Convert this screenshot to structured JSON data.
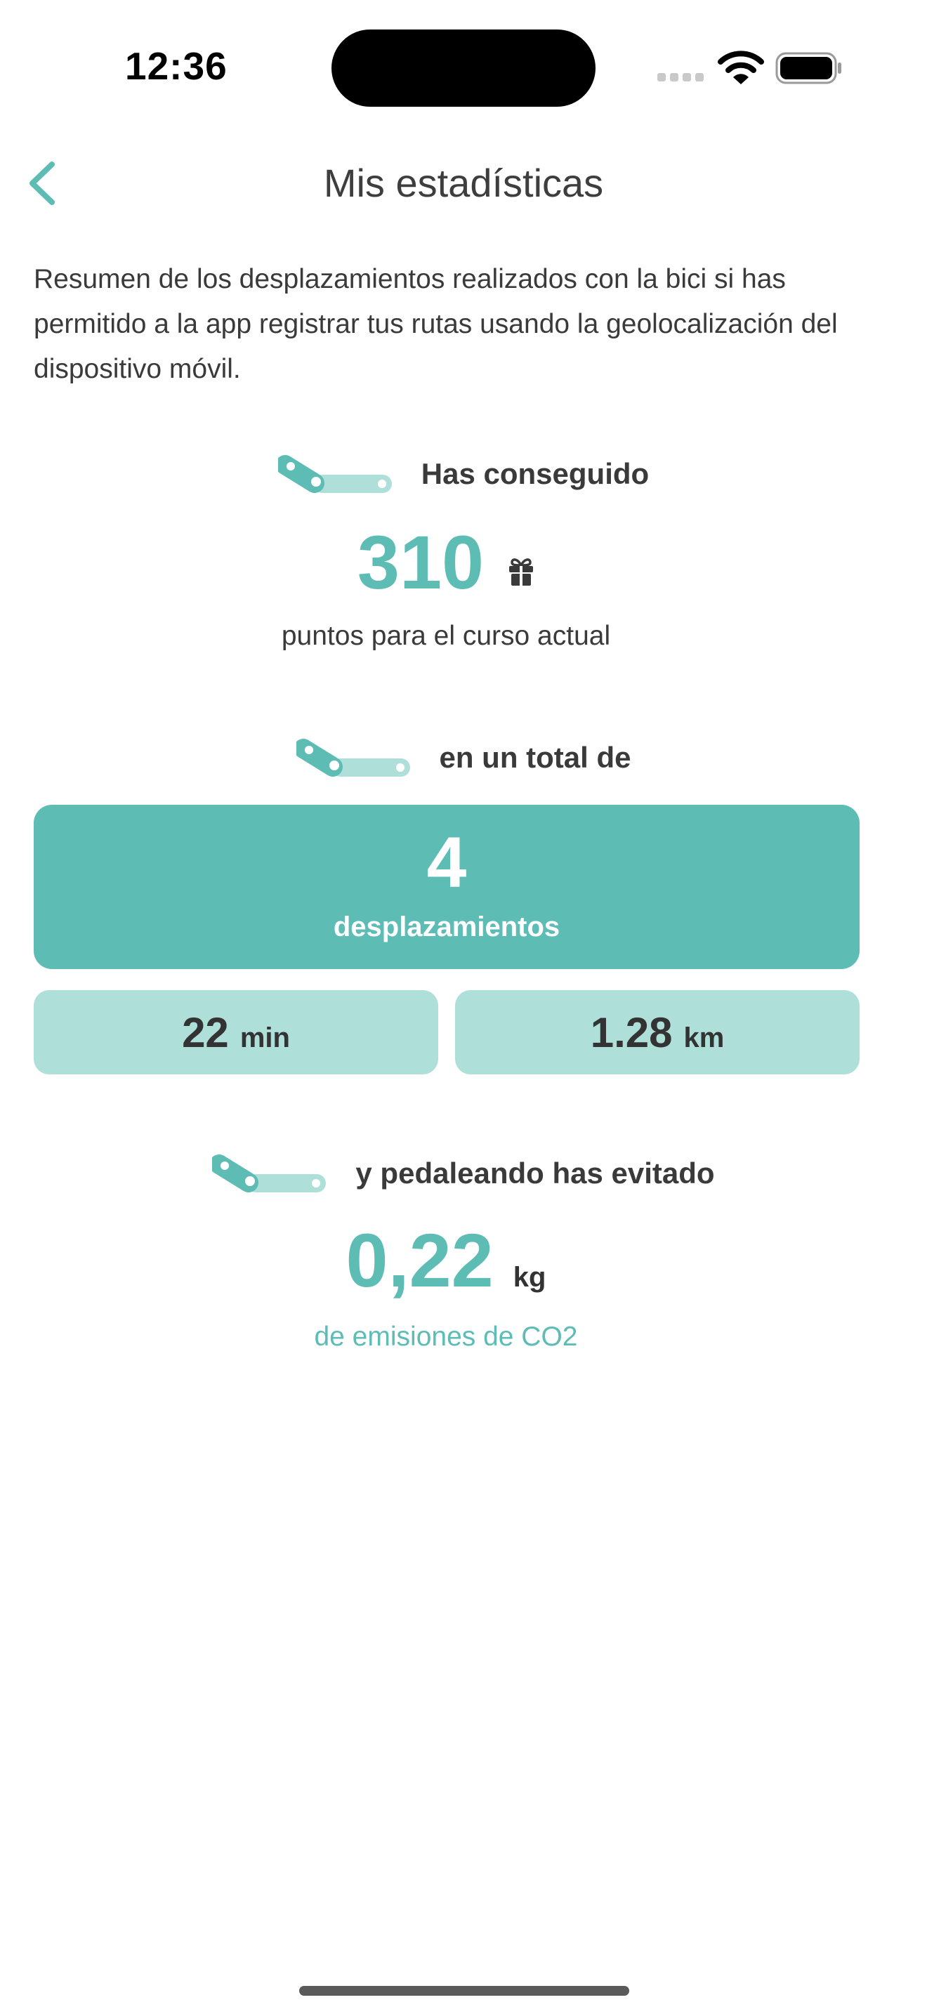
{
  "status_bar": {
    "time": "12:36"
  },
  "nav": {
    "title": "Mis estadísticas",
    "back_icon": "chevron-left-icon"
  },
  "intro": "Resumen de los desplazamientos realizados con la bici si has permitido a la app registrar tus rutas usando la geolocalización del dispositivo móvil.",
  "points": {
    "heading": "Has conseguido",
    "value": "310",
    "caption": "puntos para el curso actual",
    "icon": "gift-icon"
  },
  "trips": {
    "heading": "en un total de",
    "value": "4",
    "label": "desplazamientos",
    "duration_value": "22",
    "duration_unit": "min",
    "distance_value": "1.28",
    "distance_unit": "km"
  },
  "co2": {
    "heading": "y pedaleando has evitado",
    "value": "0,22",
    "unit": "kg",
    "caption": "de emisiones de CO2"
  },
  "colors": {
    "accent": "#5dbdb5",
    "accent_light": "#aedfd9",
    "text": "#3a3a3a"
  }
}
